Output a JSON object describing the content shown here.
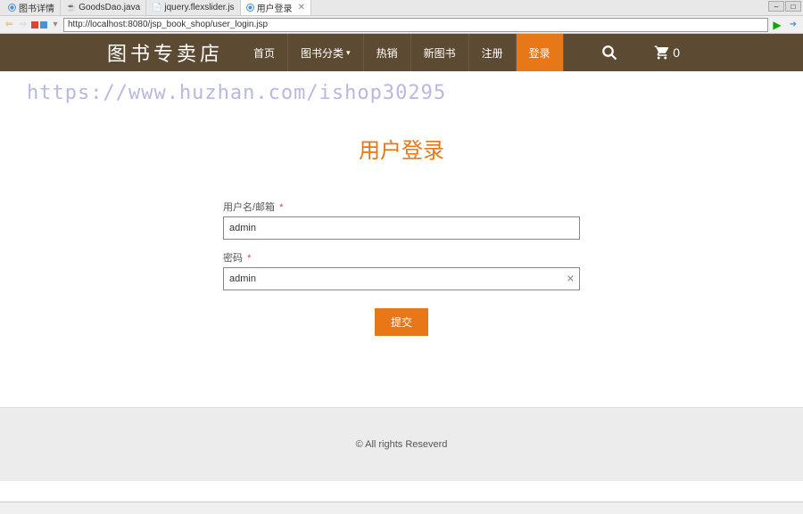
{
  "browser": {
    "tabs": [
      {
        "label": "图书详情",
        "type": "globe"
      },
      {
        "label": "GoodsDao.java",
        "type": "java"
      },
      {
        "label": "jquery.flexslider.js",
        "type": "js"
      },
      {
        "label": "用户登录",
        "type": "globe",
        "active": true
      }
    ],
    "url": "http://localhost:8080/jsp_book_shop/user_login.jsp"
  },
  "header": {
    "logo": "图书专卖店",
    "nav": [
      {
        "label": "首页"
      },
      {
        "label": "图书分类",
        "dropdown": true
      },
      {
        "label": "热销"
      },
      {
        "label": "新图书"
      },
      {
        "label": "注册"
      },
      {
        "label": "登录",
        "active": true
      }
    ],
    "cart_count": "0"
  },
  "watermark": "https://www.huzhan.com/ishop30295",
  "login": {
    "title": "用户登录",
    "username_label": "用户名/邮箱",
    "username_value": "admin",
    "password_label": "密码",
    "password_value": "admin",
    "submit_label": "提交"
  },
  "footer": {
    "text": "© All rights Reseverd"
  }
}
